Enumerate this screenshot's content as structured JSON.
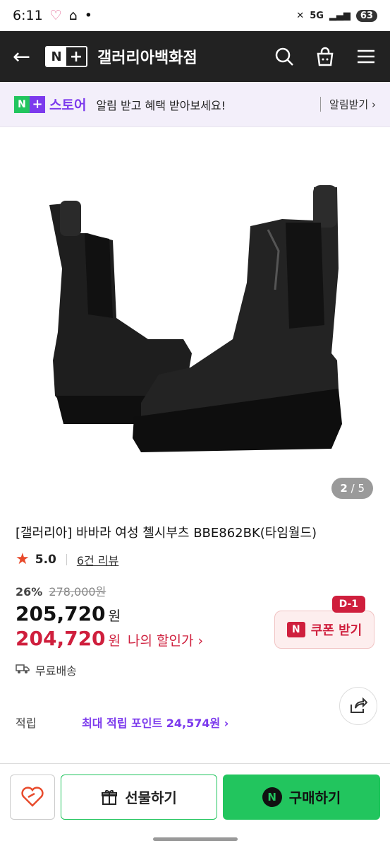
{
  "status": {
    "time": "6:11",
    "network": "5G",
    "battery": "63"
  },
  "header": {
    "logo_n": "N",
    "logo_plus": "+",
    "title": "갤러리아백화점"
  },
  "banner": {
    "logo_n": "N",
    "logo_plus": "+",
    "store": "스토어",
    "text": "알림 받고 혜택 받아보세요!",
    "button": "알림받기 ›"
  },
  "gallery": {
    "current": "2",
    "total": "/ 5"
  },
  "product": {
    "name": "[갤러리아] 바바라 여성 첼시부츠 BBE862BK(타임월드)",
    "rating": "5.0",
    "reviews": "6건 리뷰",
    "discount": "26%",
    "original_price": "278,000원",
    "price": "205,720",
    "won": "원",
    "my_price": "204,720",
    "my_label": "나의 할인가 ›",
    "shipping": "무료배송"
  },
  "coupon": {
    "badge": "D-1",
    "label": "쿠폰 받기",
    "icon": "N"
  },
  "points": {
    "label": "적립",
    "value": "최대 적립 포인트 24,574원 ›"
  },
  "bottom": {
    "gift": "선물하기",
    "buy": "구매하기",
    "buy_icon": "N"
  },
  "colors": {
    "accent_green": "#22c55e",
    "accent_purple": "#7c3aed",
    "sale_red": "#cf1f3d"
  }
}
